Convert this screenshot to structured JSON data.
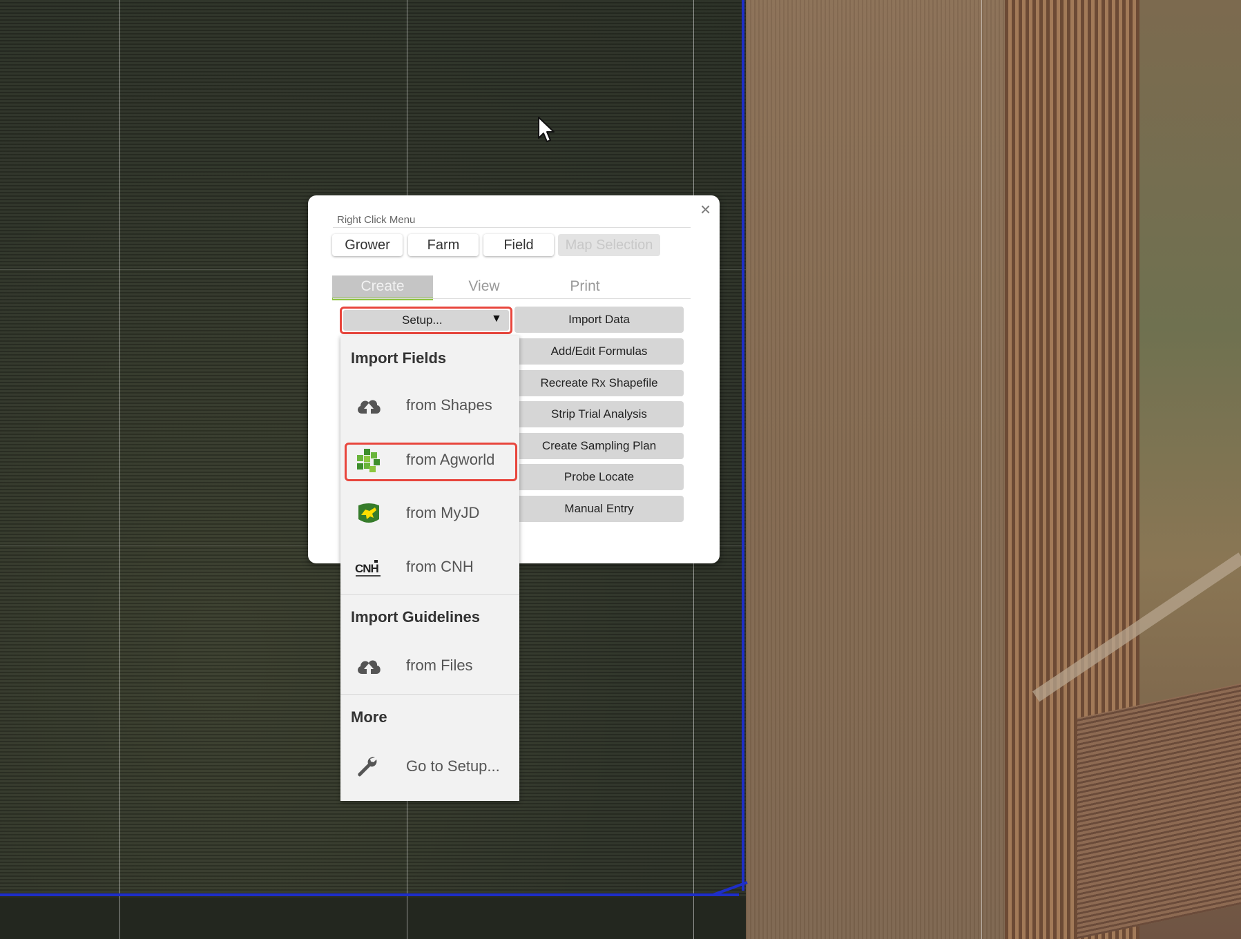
{
  "dialog": {
    "title": "Right Click Menu",
    "close_glyph": "×",
    "scope_tabs": [
      {
        "label": "Grower",
        "enabled": true
      },
      {
        "label": "Farm",
        "enabled": true
      },
      {
        "label": "Field",
        "enabled": true
      },
      {
        "label": "Map Selection",
        "enabled": false
      }
    ],
    "mode_tabs": [
      {
        "label": "Create",
        "active": true
      },
      {
        "label": "View",
        "active": false
      },
      {
        "label": "Print",
        "active": false
      }
    ],
    "setup_select": {
      "label": "Setup...",
      "arrow": "▼"
    },
    "actions": [
      "Import Data",
      "Add/Edit Formulas",
      "Recreate Rx Shapefile",
      "Strip Trial Analysis",
      "Create Sampling Plan",
      "Probe Locate",
      "Manual Entry"
    ]
  },
  "dropdown": {
    "import_fields": {
      "heading": "Import Fields",
      "items": [
        {
          "label": "from Shapes",
          "icon": "cloud-upload-icon"
        },
        {
          "label": "from Agworld",
          "icon": "agworld-icon"
        },
        {
          "label": "from MyJD",
          "icon": "john-deere-icon"
        },
        {
          "label": "from CNH",
          "icon": "cnh-icon"
        }
      ]
    },
    "import_guidelines": {
      "heading": "Import Guidelines",
      "items": [
        {
          "label": "from Files",
          "icon": "cloud-upload-icon"
        }
      ]
    },
    "more": {
      "heading": "More",
      "items": [
        {
          "label": "Go to Setup...",
          "icon": "wrench-icon"
        }
      ]
    }
  },
  "colors": {
    "highlight": "#e8453c",
    "active_tab_underline": "#8ec341",
    "field_boundary": "#1e2ec8"
  }
}
